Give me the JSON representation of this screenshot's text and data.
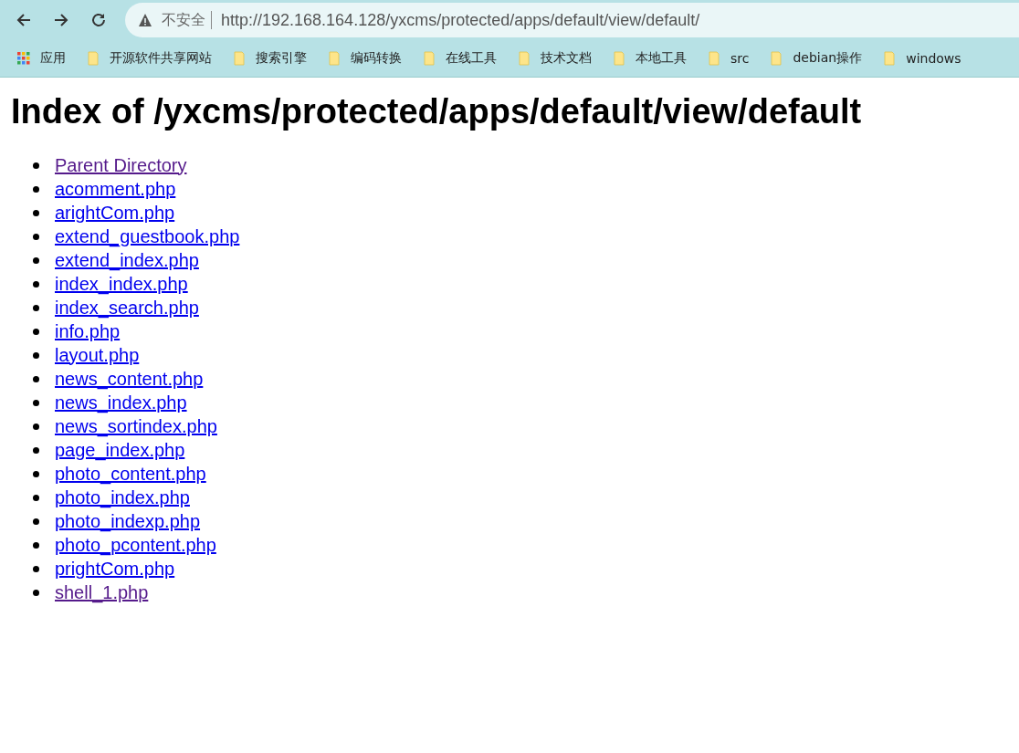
{
  "browser": {
    "security_label": "不安全",
    "url": "http://192.168.164.128/yxcms/protected/apps/default/view/default/"
  },
  "bookmarks": [
    {
      "kind": "apps",
      "label": "应用"
    },
    {
      "kind": "folder",
      "label": "开源软件共享网站"
    },
    {
      "kind": "folder",
      "label": "搜索引擎"
    },
    {
      "kind": "folder",
      "label": "编码转换"
    },
    {
      "kind": "folder",
      "label": "在线工具"
    },
    {
      "kind": "folder",
      "label": "技术文档"
    },
    {
      "kind": "folder",
      "label": "本地工具"
    },
    {
      "kind": "folder",
      "label": "src"
    },
    {
      "kind": "folder",
      "label": "debian操作"
    },
    {
      "kind": "folder",
      "label": "windows"
    }
  ],
  "page": {
    "heading": "Index of /yxcms/protected/apps/default/view/default",
    "links": [
      {
        "label": "Parent Directory",
        "visited": true
      },
      {
        "label": "acomment.php",
        "visited": false
      },
      {
        "label": "arightCom.php",
        "visited": false
      },
      {
        "label": "extend_guestbook.php",
        "visited": false
      },
      {
        "label": "extend_index.php",
        "visited": false
      },
      {
        "label": "index_index.php",
        "visited": false
      },
      {
        "label": "index_search.php",
        "visited": false
      },
      {
        "label": "info.php",
        "visited": false
      },
      {
        "label": "layout.php",
        "visited": false
      },
      {
        "label": "news_content.php",
        "visited": false
      },
      {
        "label": "news_index.php",
        "visited": false
      },
      {
        "label": "news_sortindex.php",
        "visited": false
      },
      {
        "label": "page_index.php",
        "visited": false
      },
      {
        "label": "photo_content.php",
        "visited": false
      },
      {
        "label": "photo_index.php",
        "visited": false
      },
      {
        "label": "photo_indexp.php",
        "visited": false
      },
      {
        "label": "photo_pcontent.php",
        "visited": false
      },
      {
        "label": "prightCom.php",
        "visited": false
      },
      {
        "label": "shell_1.php",
        "visited": true
      }
    ]
  }
}
